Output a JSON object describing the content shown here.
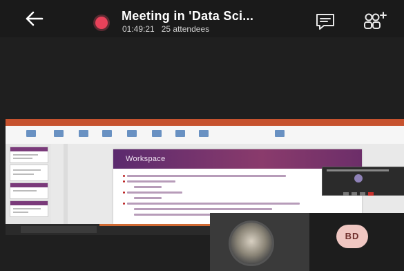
{
  "header": {
    "title": "Meeting in 'Data Sci...",
    "duration": "01:49:21",
    "attendees": "25 attendees"
  },
  "shared_screen": {
    "slide_title": "Workspace"
  },
  "participants": [
    {
      "type": "video"
    },
    {
      "initials": "BD"
    }
  ],
  "colors": {
    "recording": "#e8425a",
    "background": "#1f1f1f",
    "avatar_bg": "#f0c7c2"
  },
  "icons": [
    "back-arrow-icon",
    "recording-icon",
    "chat-icon",
    "people-add-icon"
  ]
}
